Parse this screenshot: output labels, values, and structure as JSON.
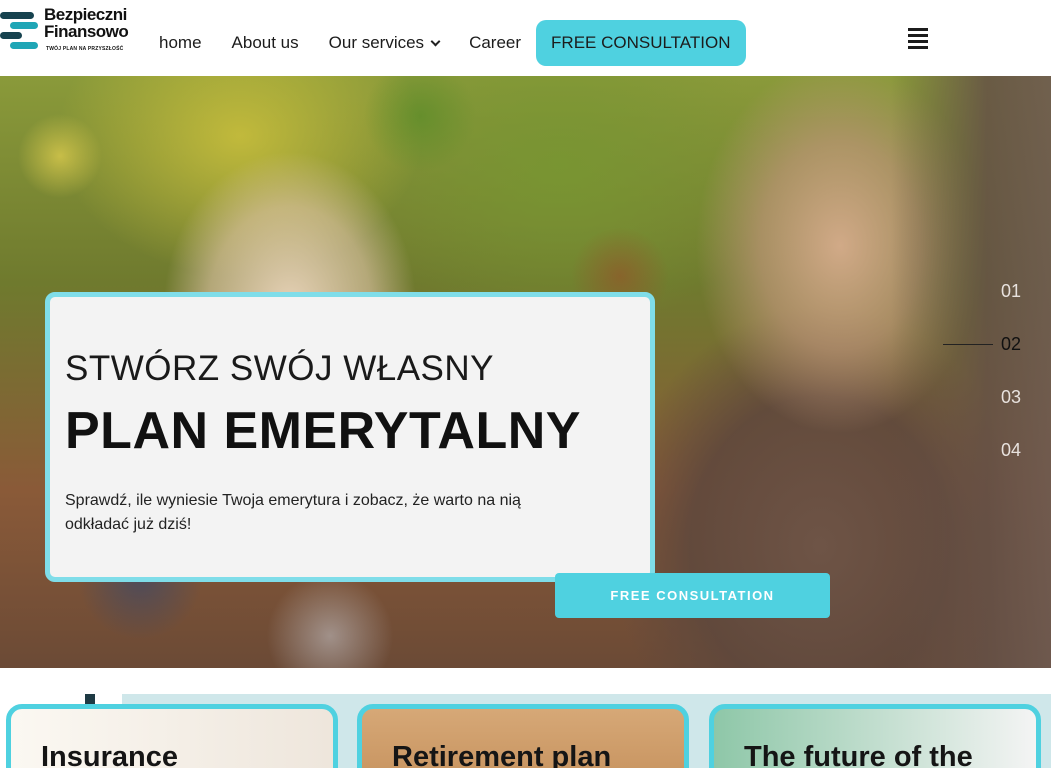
{
  "header": {
    "logo": {
      "name_line1": "Bezpieczni",
      "name_line2": "Finansowo",
      "tagline": "TWÓJ PLAN NA PRZYSZŁOŚĆ"
    },
    "nav": [
      {
        "label": "home"
      },
      {
        "label": "About us"
      },
      {
        "label": "Our services"
      },
      {
        "label": "Career"
      }
    ],
    "cta_label": "FREE CONSULTATION"
  },
  "hero": {
    "promo_line1": "STWÓRZ SWÓJ WŁASNY",
    "promo_line2": "PLAN EMERYTALNY",
    "promo_text": "Sprawdź, ile wyniesie Twoja emerytura i zobacz, że warto na nią odkładać już dziś!",
    "cta_label": "FREE CONSULTATION",
    "slides": [
      "01",
      "02",
      "03",
      "04"
    ],
    "active_slide": "02"
  },
  "cards": [
    {
      "title": "Insurance"
    },
    {
      "title": "Retirement plan"
    },
    {
      "title": "The future of the"
    }
  ],
  "colors": {
    "accent": "#4fd1e0",
    "promo_border": "#7fdde9",
    "logo_teal": "#1fa6b6",
    "logo_dark": "#16424f"
  },
  "icons": [
    "menu-icon",
    "chevron-down-icon"
  ]
}
